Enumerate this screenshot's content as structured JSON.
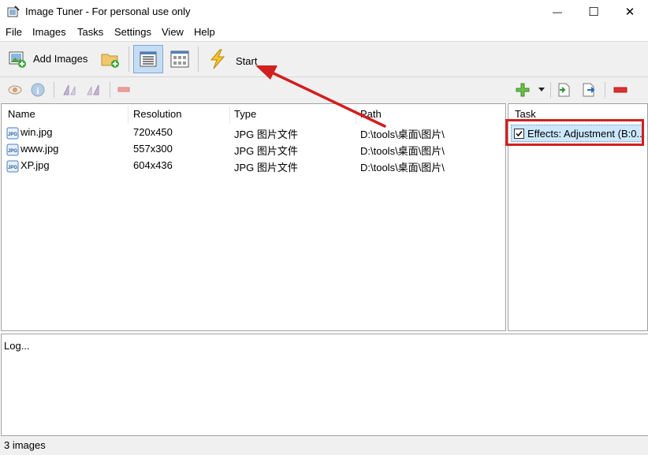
{
  "window": {
    "title": "Image Tuner - For personal use only",
    "minimize_glyph": "—",
    "maximize_glyph": "☐",
    "close_glyph": "✕"
  },
  "menu": [
    "File",
    "Images",
    "Tasks",
    "Settings",
    "View",
    "Help"
  ],
  "toolbar": {
    "add_images_label": "Add Images",
    "start_label": "Start"
  },
  "file_list": {
    "columns": [
      "Name",
      "Resolution",
      "Type",
      "Path"
    ],
    "rows": [
      {
        "name": "win.jpg",
        "resolution": "720x450",
        "type": "JPG 图片文件",
        "path": "D:\\tools\\桌面\\图片\\"
      },
      {
        "name": "www.jpg",
        "resolution": "557x300",
        "type": "JPG 图片文件",
        "path": "D:\\tools\\桌面\\图片\\"
      },
      {
        "name": "XP.jpg",
        "resolution": "604x436",
        "type": "JPG 图片文件",
        "path": "D:\\tools\\桌面\\图片\\"
      }
    ]
  },
  "task_panel": {
    "header": "Task",
    "items": [
      {
        "label": "Effects: Adjustment (B:0...",
        "checked": true
      }
    ]
  },
  "log": {
    "placeholder": "Log..."
  },
  "status": {
    "text": "3 images"
  },
  "colors": {
    "highlight_box": "#d21f1f",
    "arrow": "#d21f1f",
    "selection": "#cce8ff",
    "toggle_active": "#c5dcf5"
  },
  "icons": {
    "app": "image-tuner-icon",
    "add_images": "add-images-icon",
    "add_folder": "add-folder-icon",
    "list_view": "list-view-icon",
    "thumbnail_view": "thumbnail-view-icon",
    "start": "lightning-icon",
    "preview": "eye-icon",
    "info": "info-icon",
    "rotate_left": "rotate-left-icon",
    "rotate_right": "rotate-right-icon",
    "remove_image": "minus-icon",
    "add_task": "plus-icon",
    "import_task": "import-icon",
    "export_task": "export-icon",
    "remove_task": "minus-icon"
  }
}
